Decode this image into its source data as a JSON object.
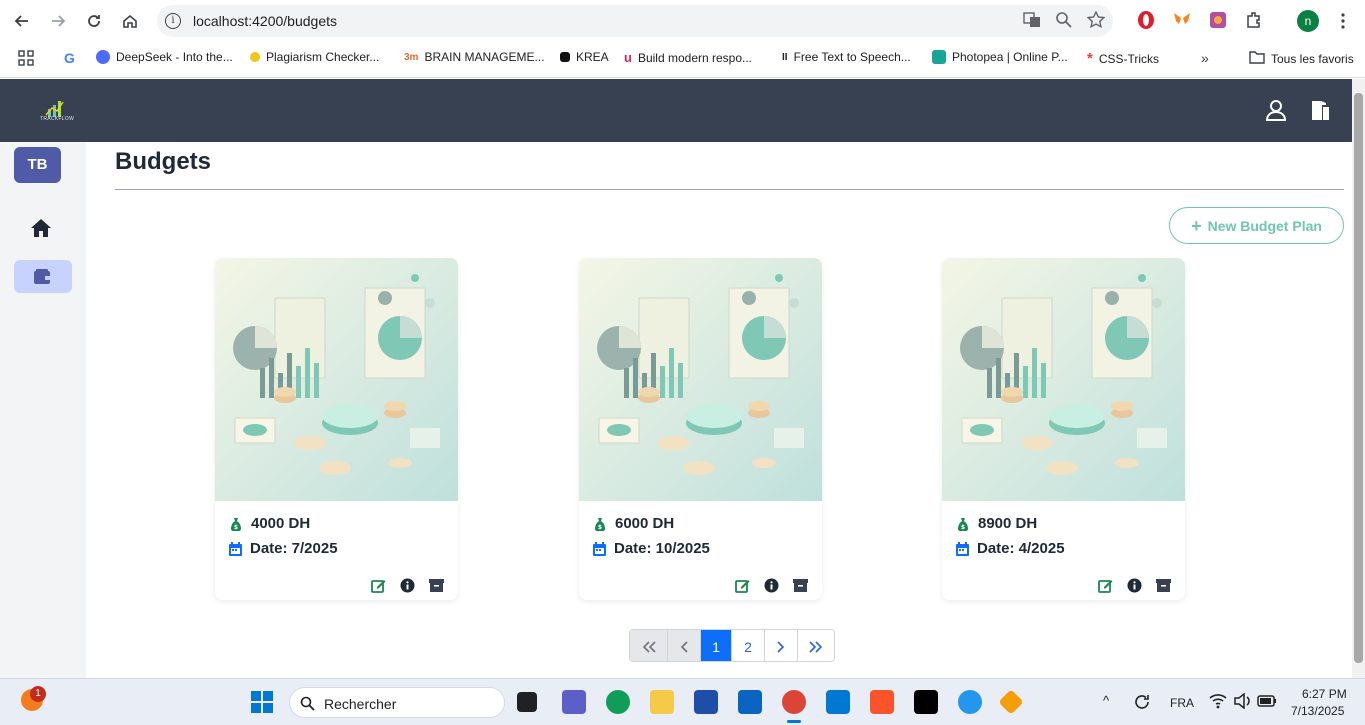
{
  "browser": {
    "url": "localhost:4200/budgets",
    "profile_initial": "n",
    "bookmarks": [
      {
        "label": "DeepSeek - Into the..."
      },
      {
        "label": "Plagiarism Checker..."
      },
      {
        "label": "BRAIN MANAGEME..."
      },
      {
        "label": "KREA"
      },
      {
        "label": "Build modern respo..."
      },
      {
        "label": "Free Text to Speech..."
      },
      {
        "label": "Photopea | Online P..."
      },
      {
        "label": "CSS-Tricks"
      }
    ],
    "all_bookmarks_label": "Tous les favoris"
  },
  "app": {
    "brand": "TRACKFLOW",
    "sidebar": {
      "badge": "TB"
    },
    "page_title": "Budgets",
    "new_button_label": "New Budget Plan",
    "cards": [
      {
        "amount": "4000 DH",
        "date": "Date: 7/2025"
      },
      {
        "amount": "6000 DH",
        "date": "Date: 10/2025"
      },
      {
        "amount": "8900 DH",
        "date": "Date: 4/2025"
      }
    ],
    "pagination": {
      "pages": [
        "1",
        "2"
      ],
      "current": "1"
    }
  },
  "taskbar": {
    "search_placeholder": "Rechercher",
    "language": "FRA",
    "time": "6:27 PM",
    "date": "7/13/2025",
    "notification_count": "1"
  },
  "colors": {
    "appbar": "#374151",
    "accent_teal": "#6fc7b0",
    "primary_blue": "#0d6efd",
    "badge": "#4f5ba7"
  }
}
